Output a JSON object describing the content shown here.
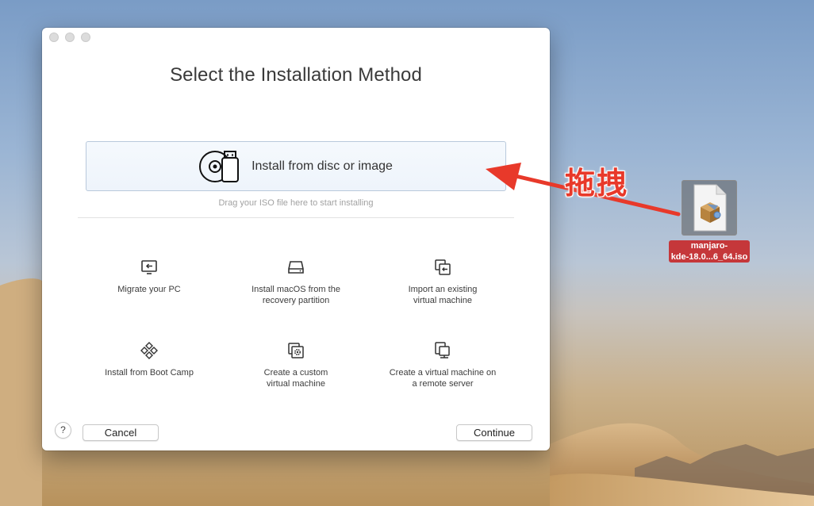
{
  "window": {
    "title": "Select the Installation Method",
    "primary_option": {
      "label": "Install from disc or image",
      "hint": "Drag your ISO file here to start installing"
    },
    "options": [
      {
        "label": "Migrate your PC",
        "icon": "monitor-arrow-icon"
      },
      {
        "label": "Install macOS from the\nrecovery partition",
        "icon": "hard-drive-icon"
      },
      {
        "label": "Import an existing\nvirtual machine",
        "icon": "import-vm-icon"
      },
      {
        "label": "Install from Boot Camp",
        "icon": "bootcamp-diamond-icon"
      },
      {
        "label": "Create a custom\nvirtual machine",
        "icon": "custom-vm-gear-icon"
      },
      {
        "label": "Create a virtual machine on\na remote server",
        "icon": "remote-server-icon"
      }
    ],
    "help_label": "?",
    "cancel_label": "Cancel",
    "continue_label": "Continue"
  },
  "annotation": {
    "text": "拖拽",
    "color": "#e8392a"
  },
  "desktop_file": {
    "name_line1": "manjaro-",
    "name_line2": "kde-18.0...6_64.iso",
    "label_color": "#c5373a"
  }
}
